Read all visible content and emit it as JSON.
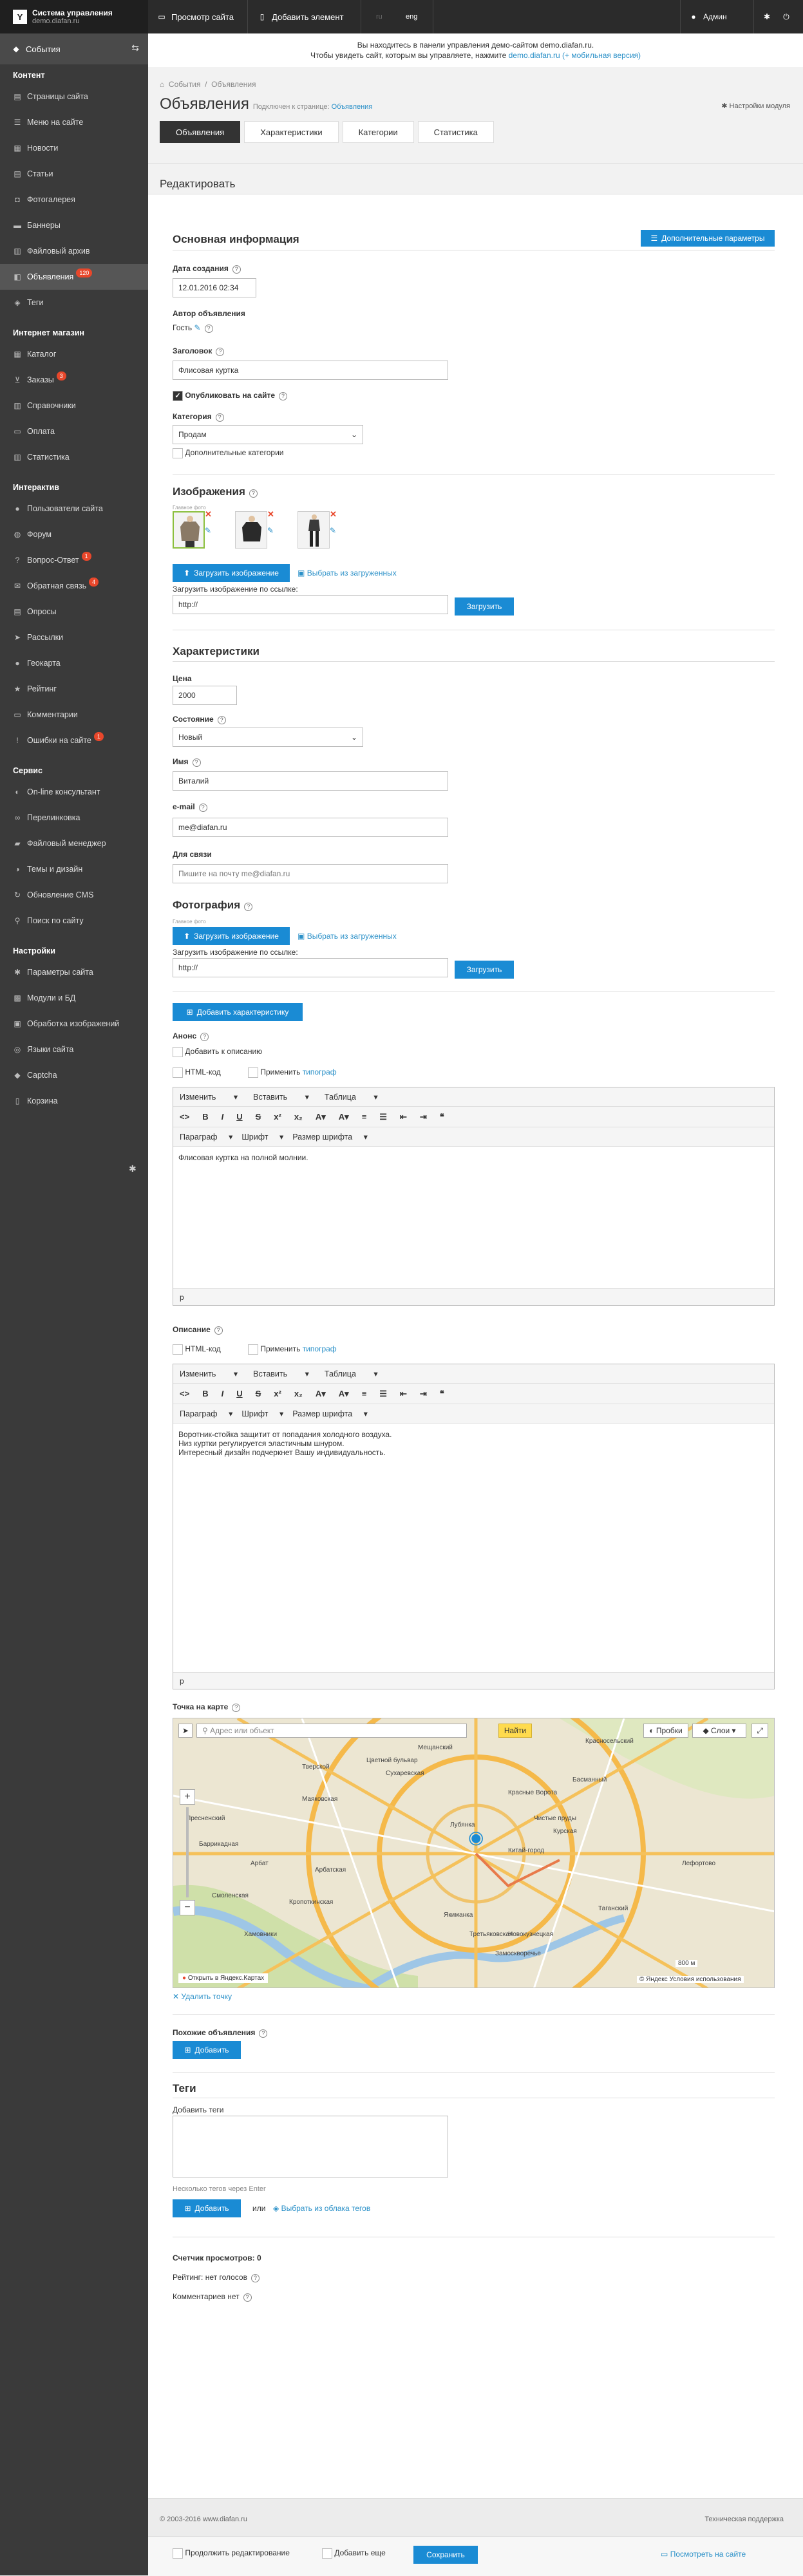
{
  "app": {
    "title": "Система управления",
    "subtitle": "demo.diafan.ru",
    "logo_letter": "Y"
  },
  "topbar": {
    "view_site": "Просмотр сайта",
    "add_element": "Добавить элемент",
    "lang_ru": "ru",
    "lang_en": "eng",
    "user": "Админ"
  },
  "sidebar": {
    "events": "События",
    "sections": [
      {
        "title": "Контент",
        "items": [
          {
            "label": "Страницы сайта",
            "icon": "file-icon"
          },
          {
            "label": "Меню на сайте",
            "icon": "menu-icon"
          },
          {
            "label": "Новости",
            "icon": "news-icon"
          },
          {
            "label": "Статьи",
            "icon": "article-icon"
          },
          {
            "label": "Фотогалерея",
            "icon": "camera-icon"
          },
          {
            "label": "Баннеры",
            "icon": "banner-icon"
          },
          {
            "label": "Файловый архив",
            "icon": "archive-icon"
          },
          {
            "label": "Объявления",
            "icon": "ads-icon",
            "badge": "120",
            "active": true
          },
          {
            "label": "Теги",
            "icon": "tag-icon"
          }
        ]
      },
      {
        "title": "Интернет магазин",
        "items": [
          {
            "label": "Каталог",
            "icon": "catalog-icon"
          },
          {
            "label": "Заказы",
            "icon": "cart-icon",
            "badge": "3"
          },
          {
            "label": "Справочники",
            "icon": "book-icon"
          },
          {
            "label": "Оплата",
            "icon": "card-icon"
          },
          {
            "label": "Статистика",
            "icon": "chart-icon"
          }
        ]
      },
      {
        "title": "Интерактив",
        "items": [
          {
            "label": "Пользователи сайта",
            "icon": "user-icon"
          },
          {
            "label": "Форум",
            "icon": "forum-icon"
          },
          {
            "label": "Вопрос-Ответ",
            "icon": "question-icon",
            "badge": "1"
          },
          {
            "label": "Обратная связь",
            "icon": "mail-icon",
            "badge": "4"
          },
          {
            "label": "Опросы",
            "icon": "poll-icon"
          },
          {
            "label": "Рассылки",
            "icon": "send-icon"
          },
          {
            "label": "Геокарта",
            "icon": "pin-icon"
          },
          {
            "label": "Рейтинг",
            "icon": "star-icon"
          },
          {
            "label": "Комментарии",
            "icon": "comment-icon"
          },
          {
            "label": "Ошибки на сайте",
            "icon": "error-icon",
            "badge": "1"
          }
        ]
      },
      {
        "title": "Сервис",
        "items": [
          {
            "label": "On-line консультант",
            "icon": "chat-icon"
          },
          {
            "label": "Перелинковка",
            "icon": "link-icon"
          },
          {
            "label": "Файловый менеджер",
            "icon": "folder-icon"
          },
          {
            "label": "Темы и дизайн",
            "icon": "palette-icon"
          },
          {
            "label": "Обновление CMS",
            "icon": "refresh-icon"
          },
          {
            "label": "Поиск по сайту",
            "icon": "search-icon"
          }
        ]
      },
      {
        "title": "Настройки",
        "items": [
          {
            "label": "Параметры сайта",
            "icon": "gear-icon"
          },
          {
            "label": "Модули и БД",
            "icon": "puzzle-icon"
          },
          {
            "label": "Обработка изображений",
            "icon": "image-icon"
          },
          {
            "label": "Языки сайта",
            "icon": "globe-icon"
          },
          {
            "label": "Captcha",
            "icon": "shield-icon"
          },
          {
            "label": "Корзина",
            "icon": "trash-icon"
          }
        ]
      }
    ]
  },
  "notice": {
    "line1": "Вы находитесь в панели управления демо-сайтом demo.diafan.ru.",
    "line2a": "Чтобы увидеть сайт, которым вы управляете, нажмите",
    "link1": "demo.diafan.ru",
    "link2": "(+ мобильная версия)"
  },
  "header": {
    "breadcrumb1": "События",
    "breadcrumb2": "Объявления",
    "title": "Объявления",
    "attached_to": "Подключен к странице:",
    "attached_link": "Объявления",
    "module_settings": "Настройки модуля",
    "tabs": [
      "Объявления",
      "Характеристики",
      "Категории",
      "Статистика"
    ]
  },
  "edit_title": "Редактировать",
  "form": {
    "basic_info": "Основная информация",
    "extra_params": "Дополнительные параметры",
    "created_label": "Дата создания",
    "created_value": "12.01.2016 02:34",
    "author_label": "Автор объявления",
    "author_value": "Гость",
    "heading_label": "Заголовок",
    "heading_value": "Флисовая куртка",
    "publish_label": "Опубликовать на сайте",
    "category_label": "Категория",
    "category_value": "Продам",
    "extra_categories": "Дополнительные категории",
    "images_title": "Изображения",
    "main_photo": "Главное фото",
    "upload_image": "Загрузить изображение",
    "choose_uploaded": "Выбрать из загруженных",
    "upload_by_link": "Загрузить изображение по ссылке:",
    "url_value": "http://",
    "upload_btn": "Загрузить",
    "chars_title": "Характеристики",
    "price_label": "Цена",
    "price_value": "2000",
    "state_label": "Состояние",
    "state_value": "Новый",
    "name_label": "Имя",
    "name_value": "Виталий",
    "email_label": "e-mail",
    "email_value": "me@diafan.ru",
    "contact_label": "Для связи",
    "contact_value": "Пишите на почту me@diafan.ru",
    "photo_title": "Фотография",
    "photo_main": "Главное фото",
    "add_char": "Добавить характеристику",
    "anons_label": "Анонс",
    "add_to_desc": "Добавить к описанию",
    "html_code": "HTML-код",
    "apply": "Применить",
    "typograph": "типограф",
    "ed_menu": [
      "Изменить",
      "Вставить",
      "Таблица"
    ],
    "ed_tools2": [
      "Параграф",
      "Шрифт",
      "Размер шрифта"
    ],
    "anons_text": "Флисовая куртка на полной молнии.",
    "desc_label": "Описание",
    "desc_lines": [
      "Воротник-стойка защитит от попадания холодного воздуха.",
      "Низ куртки регулируется эластичным шнуром.",
      "Интересный дизайн подчеркнет Вашу индивидуальность."
    ],
    "ed_p": "p",
    "map_label": "Точка на карте",
    "map_search": "Адрес или объект",
    "map_find": "Найти",
    "map_traffic": "Пробки",
    "map_layers": "Слои",
    "map_open": "Открыть в Яндекс.Картах",
    "map_copy": "© Яндекс Условия использования",
    "map_scale": "800 м",
    "delete_point": "Удалить точку",
    "similar_label": "Похожие объявления",
    "add_btn": "Добавить",
    "tags_title": "Теги",
    "add_tags": "Добавить теги",
    "tags_hint": "Несколько тегов через Enter",
    "or": "или",
    "tags_cloud": "Выбрать из облака тегов",
    "views": "Счетчик просмотров: 0",
    "rating": "Рейтинг: нет голосов",
    "comments": "Комментариев нет"
  },
  "footer": {
    "copyright": "© 2003-2016 www.diafan.ru",
    "support": "Техническая поддержка",
    "continue_edit": "Продолжить редактирование",
    "add_more": "Добавить еще",
    "save": "Сохранить",
    "view_on_site": "Посмотреть на сайте"
  },
  "map_places": [
    "Тверской",
    "Басманный",
    "Хамовники",
    "Якиманка",
    "Красносельский",
    "Таганский",
    "Замоскворечье",
    "Лефортово",
    "Мещанский",
    "Арбат",
    "Пресненский",
    "Сухаревская",
    "Красные Ворота",
    "Чистые пруды",
    "Лубянка",
    "Китай-город",
    "Курская",
    "Кропоткинская",
    "Новокузнецкая",
    "Третьяковская",
    "Смоленская",
    "Баррикадная",
    "Арбатская",
    "Маяковская",
    "Цветной бульвар"
  ],
  "colors": {
    "accent": "#1a8bd4",
    "sidebar": "#3a3a3a",
    "topbar": "#2b2b2b",
    "badge": "#e8472b"
  }
}
